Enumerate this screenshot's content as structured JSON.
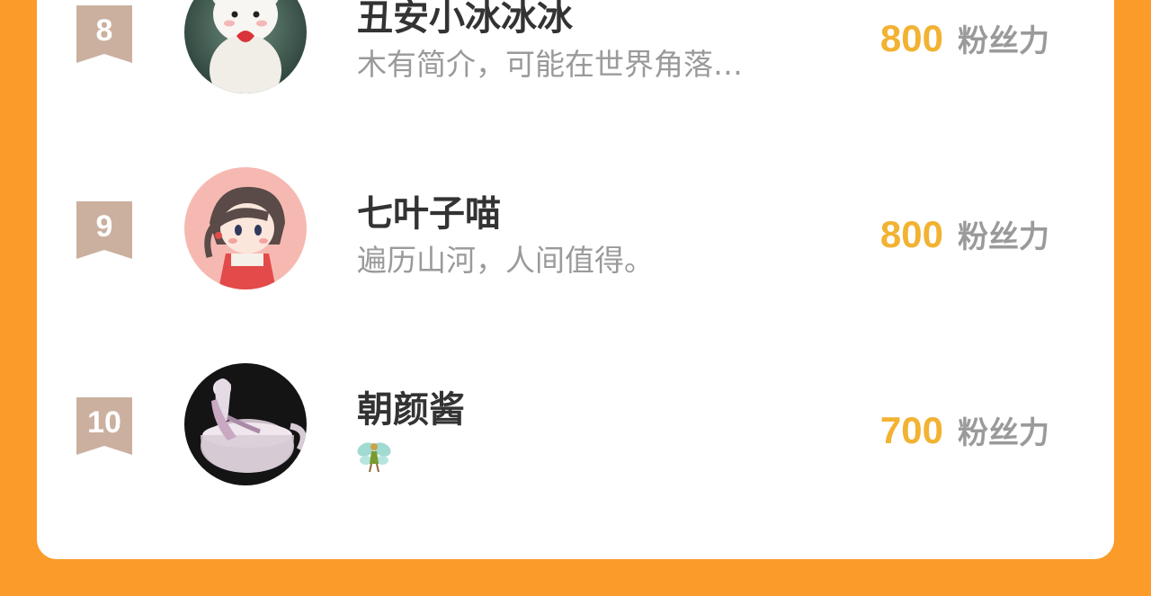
{
  "ranking": {
    "entries": [
      {
        "rank": "8",
        "name": "丑安小冰冰冰",
        "bio": "木有简介，可能在世界角落…",
        "score": "800",
        "score_unit": "粉丝力",
        "avatar_icon": "white-bunny-avatar-icon"
      },
      {
        "rank": "9",
        "name": "七叶子喵",
        "bio": "遍历山河，人间值得。",
        "score": "800",
        "score_unit": "粉丝力",
        "avatar_icon": "cartoon-girl-avatar-icon"
      },
      {
        "rank": "10",
        "name": "朝颜酱",
        "bio_icon": "fairy-emoji-icon",
        "score": "700",
        "score_unit": "粉丝力",
        "avatar_icon": "doll-in-teacup-avatar-icon"
      }
    ]
  },
  "colors": {
    "background": "#FB9B29",
    "card": "#FFFFFF",
    "rank_badge": "#CBB09F",
    "score": "#F2B232",
    "name": "#333333",
    "muted": "#9A9A9A"
  }
}
